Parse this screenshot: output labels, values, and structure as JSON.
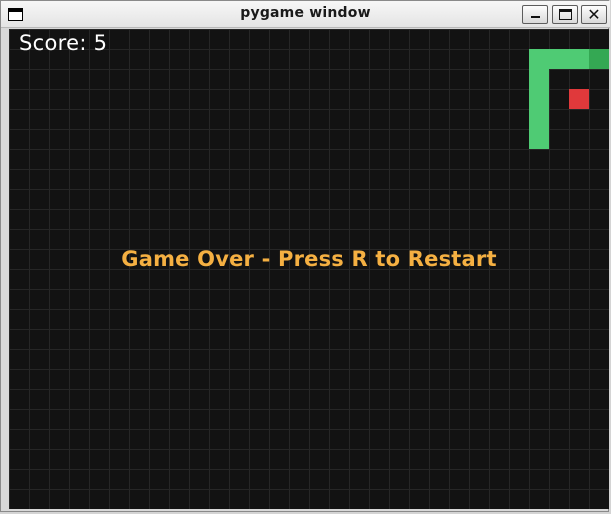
{
  "window": {
    "title": "pygame window",
    "close_glyph": "✕",
    "icons": [
      "app-window-icon",
      "minimize-icon",
      "maximize-icon",
      "close-icon"
    ]
  },
  "hud": {
    "score_text": "Score: 5",
    "game_over_text": "Game Over - Press R to Restart"
  },
  "colors": {
    "background": "#121212",
    "grid": "#262626",
    "snake_body": "#4fcb74",
    "snake_head": "#34a853",
    "food": "#e0393b",
    "score_text": "#ffffff",
    "game_over_text": "#f5b042"
  },
  "game": {
    "grid_cols": 30,
    "grid_rows": 24,
    "snake": [
      {
        "col": 29,
        "row": 1
      },
      {
        "col": 28,
        "row": 1
      },
      {
        "col": 27,
        "row": 1
      },
      {
        "col": 26,
        "row": 1
      },
      {
        "col": 26,
        "row": 2
      },
      {
        "col": 26,
        "row": 3
      },
      {
        "col": 26,
        "row": 4
      },
      {
        "col": 26,
        "row": 5
      }
    ],
    "food": {
      "col": 28,
      "row": 3
    }
  }
}
